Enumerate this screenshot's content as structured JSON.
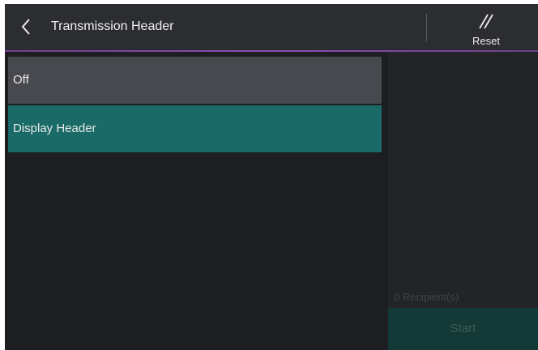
{
  "header": {
    "title": "Transmission Header",
    "back_icon": "chevron-left-icon",
    "reset_label": "Reset",
    "reset_icon": "double-slash-icon"
  },
  "options": [
    {
      "label": "Off",
      "selected": false
    },
    {
      "label": "Display Header",
      "selected": true
    }
  ],
  "side_panel": {
    "recipients_text": "0 Recipient(s)",
    "start_label": "Start"
  },
  "colors": {
    "background": "#1c1e21",
    "header": "#2b2d31",
    "accent": "#8a4fb0",
    "option_default": "#47494e",
    "option_selected": "#1a6a67",
    "start_disabled": "#143a38"
  }
}
